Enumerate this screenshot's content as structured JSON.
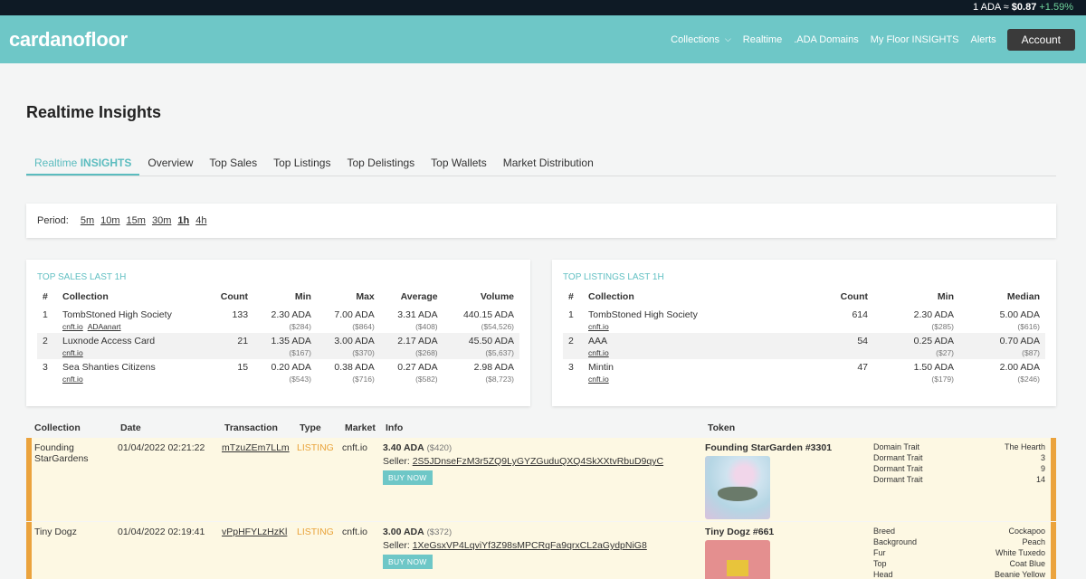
{
  "ticker": {
    "prefix": "1 ADA ≈",
    "price": "$0.87",
    "change": "+1.59%"
  },
  "brand": {
    "part1": "cardano",
    "part2": "floor"
  },
  "nav": {
    "collections": "Collections",
    "realtime": "Realtime",
    "domains": ".ADA Domains",
    "insights": "My Floor INSIGHTS",
    "alerts": "Alerts",
    "account": "Account"
  },
  "page_title": "Realtime Insights",
  "tabs": {
    "t0a": "Realtime",
    "t0b": "INSIGHTS",
    "t1": "Overview",
    "t2": "Top Sales",
    "t3": "Top Listings",
    "t4": "Top Delistings",
    "t5": "Top Wallets",
    "t6": "Market Distribution"
  },
  "period": {
    "label": "Period:",
    "options": [
      "5m",
      "10m",
      "15m",
      "30m",
      "1h",
      "4h"
    ],
    "selected": "1h"
  },
  "top_sales": {
    "title": "TOP SALES LAST 1H",
    "headers": [
      "#",
      "Collection",
      "Count",
      "Min",
      "Max",
      "Average",
      "Volume"
    ],
    "rows": [
      {
        "n": "1",
        "name": "TombStoned High Society",
        "link1": "cnft.io",
        "link2": "ADAanart",
        "count": "133",
        "min": "2.30 ADA",
        "min_usd": "($284)",
        "max": "7.00 ADA",
        "max_usd": "($864)",
        "avg": "3.31 ADA",
        "avg_usd": "($408)",
        "vol": "440.15 ADA",
        "vol_usd": "($54,526)"
      },
      {
        "n": "2",
        "name": "Luxnode Access Card",
        "link1": "cnft.io",
        "link2": "",
        "count": "21",
        "min": "1.35 ADA",
        "min_usd": "($167)",
        "max": "3.00 ADA",
        "max_usd": "($370)",
        "avg": "2.17 ADA",
        "avg_usd": "($268)",
        "vol": "45.50 ADA",
        "vol_usd": "($5,637)"
      },
      {
        "n": "3",
        "name": "Sea Shanties Citizens",
        "link1": "cnft.io",
        "link2": "",
        "count": "15",
        "min": "0.20 ADA",
        "min_usd": "($543)",
        "max": "0.38 ADA",
        "max_usd": "($716)",
        "avg": "0.27 ADA",
        "avg_usd": "($582)",
        "vol": "2.98 ADA",
        "vol_usd": "($8,723)"
      }
    ]
  },
  "top_listings": {
    "title": "TOP LISTINGS LAST 1H",
    "headers": [
      "#",
      "Collection",
      "Count",
      "Min",
      "Median"
    ],
    "rows": [
      {
        "n": "1",
        "name": "TombStoned High Society",
        "link1": "cnft.io",
        "count": "614",
        "min": "2.30 ADA",
        "min_usd": "($285)",
        "med": "5.00 ADA",
        "med_usd": "($616)"
      },
      {
        "n": "2",
        "name": "AAA",
        "link1": "cnft.io",
        "count": "54",
        "min": "0.25 ADA",
        "min_usd": "($27)",
        "med": "0.70 ADA",
        "med_usd": "($87)"
      },
      {
        "n": "3",
        "name": "Mintin",
        "link1": "cnft.io",
        "count": "47",
        "min": "1.50 ADA",
        "min_usd": "($179)",
        "med": "2.00 ADA",
        "med_usd": "($246)"
      }
    ]
  },
  "feed": {
    "headers": {
      "collection": "Collection",
      "date": "Date",
      "transaction": "Transaction",
      "type": "Type",
      "market": "Market",
      "info": "Info",
      "token": "Token"
    },
    "rows": [
      {
        "collection": "Founding StarGardens",
        "date": "01/04/2022 02:21:22",
        "tx": "mTzuZEm7LLm",
        "type": "LISTING",
        "market": "cnft.io",
        "price": "3.40 ADA",
        "usd": "($420)",
        "seller_label": "Seller:",
        "seller": "2S5JDnseFzM3r5ZQ9LyGYZGuduQXQ4SkXXtvRbuD9qyC",
        "buy": "BUY NOW",
        "token": "Founding StarGarden #3301",
        "traits": [
          {
            "k": "Domain Trait",
            "v": "The Hearth"
          },
          {
            "k": "Dormant Trait",
            "v": "3"
          },
          {
            "k": "Dormant Trait",
            "v": "9"
          },
          {
            "k": "Dormant Trait",
            "v": "14"
          }
        ]
      },
      {
        "collection": "Tiny Dogz",
        "date": "01/04/2022 02:19:41",
        "tx": "vPpHFYLzHzKl",
        "type": "LISTING",
        "market": "cnft.io",
        "price": "3.00 ADA",
        "usd": "($372)",
        "seller_label": "Seller:",
        "seller": "1XeGsxVP4LqviYf3Z98sMPCRqFa9qrxCL2aGydpNiG8",
        "buy": "BUY NOW",
        "token": "Tiny Dogz #661",
        "traits": [
          {
            "k": "Breed",
            "v": "Cockapoo"
          },
          {
            "k": "Background",
            "v": "Peach"
          },
          {
            "k": "Fur",
            "v": "White Tuxedo"
          },
          {
            "k": "Top",
            "v": "Coat Blue"
          },
          {
            "k": "Head",
            "v": "Beanie Yellow"
          }
        ]
      }
    ]
  }
}
